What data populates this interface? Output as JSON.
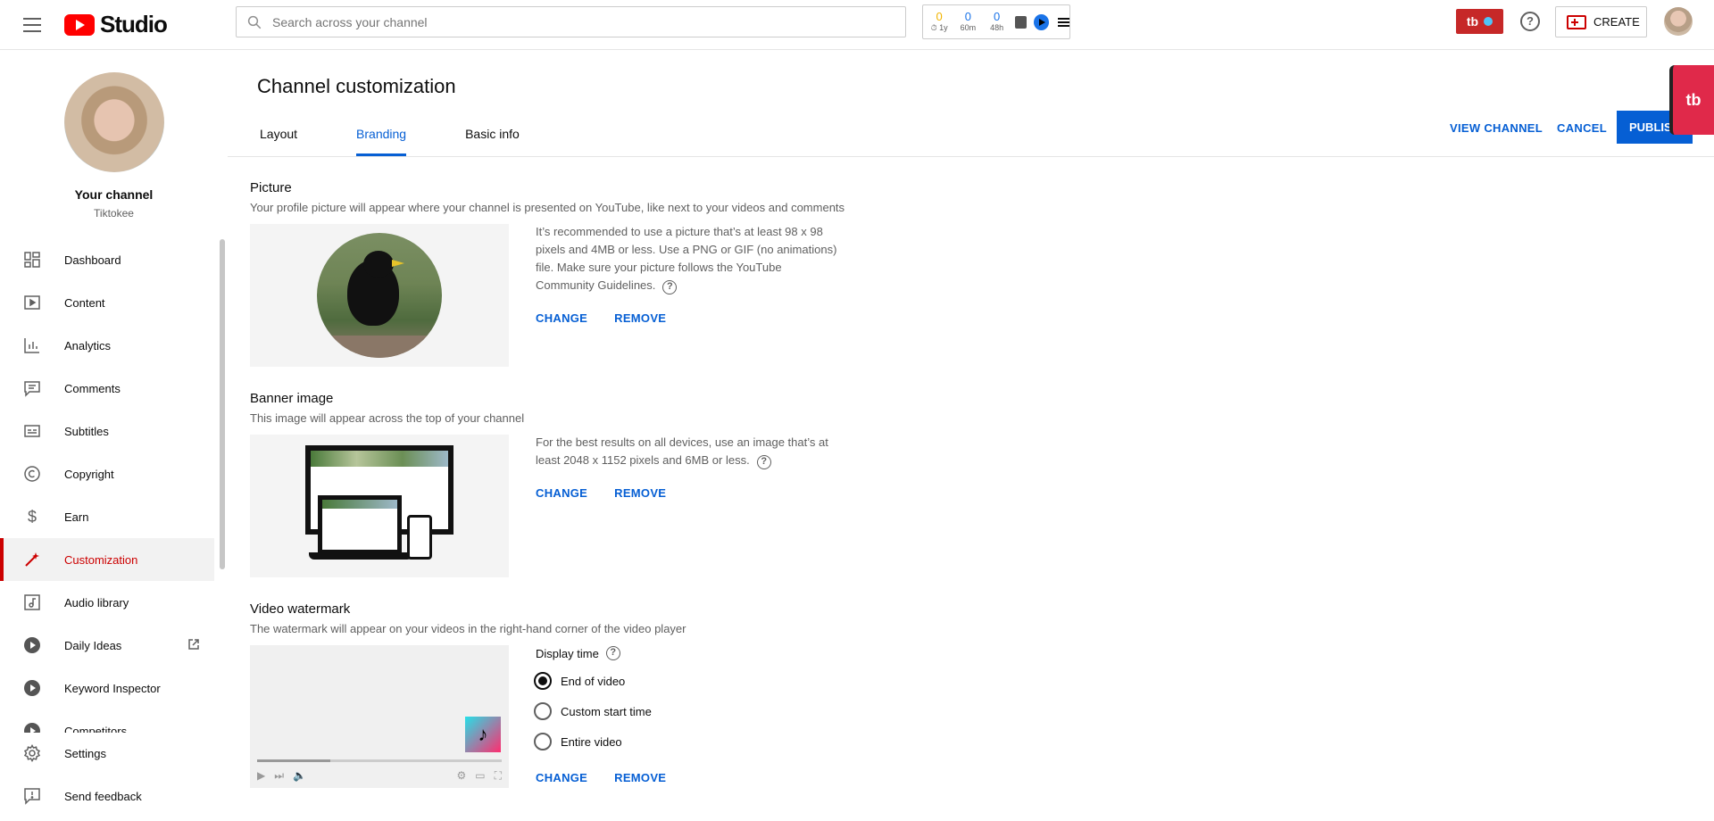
{
  "header": {
    "logo_text": "Studio",
    "search_placeholder": "Search across your channel",
    "stats": [
      {
        "value": "0",
        "label": "1y",
        "color": "#f2b400"
      },
      {
        "value": "0",
        "label": "60m",
        "color": "#1a73e8"
      },
      {
        "value": "0",
        "label": "48h",
        "color": "#1a73e8"
      }
    ],
    "tb_label": "tb",
    "help_label": "?",
    "create_label": "CREATE"
  },
  "sidebar": {
    "channel_title": "Your channel",
    "channel_name": "Tiktokee",
    "items": [
      {
        "label": "Dashboard",
        "icon": "dashboard-icon"
      },
      {
        "label": "Content",
        "icon": "content-icon"
      },
      {
        "label": "Analytics",
        "icon": "analytics-icon"
      },
      {
        "label": "Comments",
        "icon": "comments-icon"
      },
      {
        "label": "Subtitles",
        "icon": "subtitles-icon"
      },
      {
        "label": "Copyright",
        "icon": "copyright-icon"
      },
      {
        "label": "Earn",
        "icon": "dollar-icon"
      },
      {
        "label": "Customization",
        "icon": "magic-wand-icon",
        "active": true
      },
      {
        "label": "Audio library",
        "icon": "audio-library-icon"
      },
      {
        "label": "Daily Ideas",
        "icon": "play-circle-icon"
      },
      {
        "label": "Keyword Inspector",
        "icon": "play-circle-icon"
      },
      {
        "label": "Competitors",
        "icon": "play-circle-icon"
      }
    ],
    "bottom": [
      {
        "label": "Settings",
        "icon": "gear-icon"
      },
      {
        "label": "Send feedback",
        "icon": "feedback-icon"
      }
    ]
  },
  "main": {
    "title": "Channel customization",
    "tabs": [
      {
        "label": "Layout"
      },
      {
        "label": "Branding",
        "active": true
      },
      {
        "label": "Basic info"
      }
    ],
    "actions": {
      "view_channel": "VIEW CHANNEL",
      "cancel": "CANCEL",
      "publish": "PUBLISH"
    },
    "picture": {
      "title": "Picture",
      "desc": "Your profile picture will appear where your channel is presented on YouTube, like next to your videos and comments",
      "info": "It’s recommended to use a picture that’s at least 98 x 98 pixels and 4MB or less. Use a PNG or GIF (no animations) file. Make sure your picture follows the YouTube Community Guidelines.",
      "change": "CHANGE",
      "remove": "REMOVE"
    },
    "banner": {
      "title": "Banner image",
      "desc": "This image will appear across the top of your channel",
      "info": "For the best results on all devices, use an image that’s at least 2048 x 1152 pixels and 6MB or less.",
      "change": "CHANGE",
      "remove": "REMOVE"
    },
    "watermark": {
      "title": "Video watermark",
      "desc": "The watermark will appear on your videos in the right-hand corner of the video player",
      "display_time_label": "Display time",
      "options": [
        {
          "label": "End of video",
          "checked": true
        },
        {
          "label": "Custom start time",
          "checked": false
        },
        {
          "label": "Entire video",
          "checked": false
        }
      ],
      "change": "CHANGE",
      "remove": "REMOVE"
    }
  }
}
